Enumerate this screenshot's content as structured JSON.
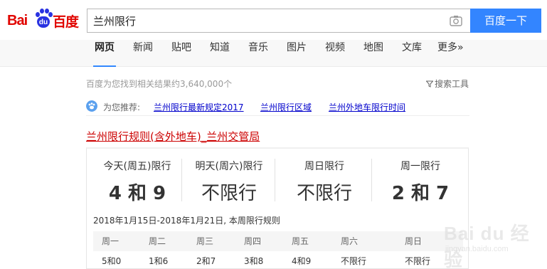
{
  "logo": {
    "latin": "Bai",
    "paw_text": "du",
    "cn": "百度"
  },
  "search": {
    "query": "兰州限行",
    "button_label": "百度一下"
  },
  "tabs": [
    {
      "label": "网页",
      "active": true
    },
    {
      "label": "新闻"
    },
    {
      "label": "贴吧"
    },
    {
      "label": "知道"
    },
    {
      "label": "音乐"
    },
    {
      "label": "图片"
    },
    {
      "label": "视频"
    },
    {
      "label": "地图"
    },
    {
      "label": "文库"
    },
    {
      "label": "更多»"
    }
  ],
  "results": {
    "count_text": "百度为您找到相关结果约3,640,000个",
    "tools_label": "搜索工具",
    "recommend_label": "为您推荐:",
    "recommend_links": [
      "兰州限行最新规定2017",
      "兰州限行区域",
      "兰州外地车限行时间"
    ],
    "title_link": "兰州限行规则(含外地车)",
    "title_site": "_兰州交管局"
  },
  "restriction_card": {
    "days": [
      {
        "label": "今天(周五)限行",
        "value": "4 和 9"
      },
      {
        "label": "明天(周六)限行",
        "value": "不限行"
      },
      {
        "label": "周日限行",
        "value": "不限行"
      },
      {
        "label": "周一限行",
        "value": "2 和 7"
      }
    ],
    "week_caption": "2018年1月15日-2018年1月21日, 本周限行规则",
    "week_headers": [
      "周一",
      "周二",
      "周三",
      "周四",
      "周五",
      "周六",
      "周日"
    ],
    "week_values": [
      "5和0",
      "1和6",
      "2和7",
      "3和8",
      "4和9",
      "不限行",
      "不限行"
    ]
  },
  "watermark": {
    "text": "Bai du 经验",
    "url": "jingyan.baidu.com"
  },
  "colors": {
    "brand_red": "#e10601",
    "brand_blue": "#2932e1",
    "button_blue": "#3385ff",
    "link_blue": "#0000cc",
    "title_red": "#cc0000"
  }
}
